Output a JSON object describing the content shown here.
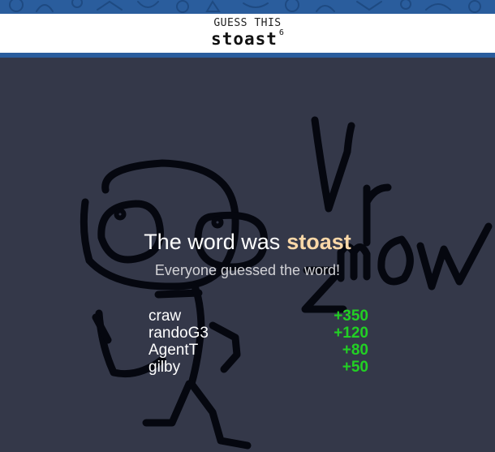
{
  "header": {
    "guess_label": "GUESS THIS",
    "word": "stoast",
    "word_length": "6"
  },
  "result": {
    "prefix": "The word was",
    "answer": "stoast",
    "subtitle": "Everyone guessed the word!"
  },
  "scores": [
    {
      "name": "craw",
      "points": "+350"
    },
    {
      "name": "randoG3",
      "points": "+120"
    },
    {
      "name": "AgentT",
      "points": "+80"
    },
    {
      "name": "gilby",
      "points": "+50"
    }
  ],
  "colors": {
    "brand": "#2a5d9d",
    "canvas": "#343849",
    "answer": "#fbd8a8",
    "points": "#22d024",
    "ink": "#05070f"
  }
}
